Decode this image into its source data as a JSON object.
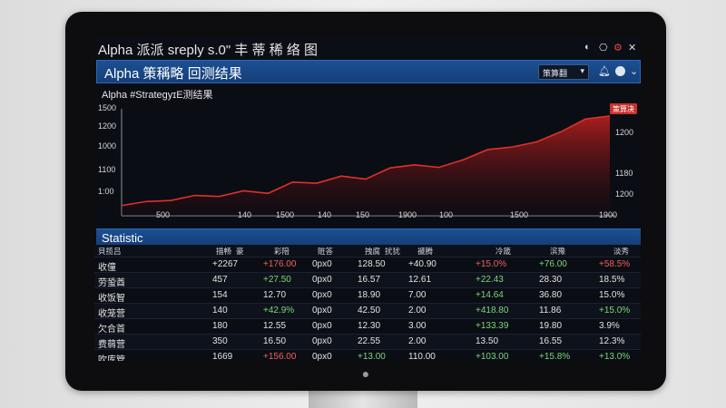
{
  "window": {
    "title": "Alpha 派派 sreply s.0\" 丰 蒂 稀 络 图",
    "controls": [
      "◐",
      "⎔",
      "⚙",
      "✕"
    ]
  },
  "header": {
    "title": "Alpha 策稱略 回测结果",
    "dropdown_label": "策算翻",
    "icons": [
      "bell-icon",
      "user-avatar",
      "chevron-down-icon"
    ]
  },
  "chart_title": "Alpha #StrategyɪЕ测结果",
  "chart_data": {
    "type": "area",
    "title": "Alpha #StrategyɪЕ测结果",
    "y_left_ticks": [
      "1500",
      "1200",
      "1000",
      "1100",
      "1:00"
    ],
    "y_right_ticks": [
      "1200",
      "1180",
      "1200"
    ],
    "x_ticks": [
      "500",
      "140",
      "1500",
      "140",
      "150",
      "1900",
      "100",
      "1500",
      "1900"
    ],
    "end_label": "策算决",
    "series": [
      {
        "values": [
          [
            0,
            600
          ],
          [
            5,
            640
          ],
          [
            10,
            650
          ],
          [
            15,
            700
          ],
          [
            20,
            690
          ],
          [
            25,
            745
          ],
          [
            30,
            720
          ],
          [
            35,
            830
          ],
          [
            40,
            820
          ],
          [
            45,
            890
          ],
          [
            50,
            860
          ],
          [
            55,
            970
          ],
          [
            60,
            1000
          ],
          [
            65,
            975
          ],
          [
            70,
            1050
          ],
          [
            75,
            1150
          ],
          [
            80,
            1175
          ],
          [
            85,
            1225
          ],
          [
            90,
            1325
          ],
          [
            95,
            1450
          ],
          [
            100,
            1480
          ]
        ]
      }
    ],
    "ylim": [
      500,
      1550
    ],
    "xlim": [
      0,
      100
    ],
    "color": "#e0302b"
  },
  "statistic": {
    "label": "Statistic",
    "columns": [
      "貝揽吕",
      "描畅",
      "豪",
      "彩陪",
      "赃答",
      "拽腐",
      "扰犹",
      "褫腾",
      "冷箴",
      "滨豫",
      "淡秀"
    ],
    "rows": [
      {
        "c0": "收僮",
        "c1": "+2267",
        "c2": "+176.00",
        "c3": "0px0",
        "c4": "128.50",
        "c5": "+40.90",
        "c6": "+15.0%",
        "c7": "+76.00",
        "c8": "+58.5%"
      },
      {
        "c0": "劳蛩酋",
        "c1": "457",
        "c2": "+27.50",
        "c3": "0px0",
        "c4": "16.57",
        "c5": "12.61",
        "c6": "+22.43",
        "c7": "28.30",
        "c8": "18.5%"
      },
      {
        "c0": "收饭智",
        "c1": "154",
        "c2": "12.70",
        "c3": "0px0",
        "c4": "18.90",
        "c5": "7.00",
        "c6": "+14.64",
        "c7": "36.80",
        "c8": "15.0%"
      },
      {
        "c0": "收笼营",
        "c1": "140",
        "c2": "+42.9%",
        "c3": "0px0",
        "c4": "42.50",
        "c5": "2.00",
        "c6": "+418.80",
        "c7": "11.86",
        "c8": "+15.0%"
      },
      {
        "c0": "欠合首",
        "c1": "180",
        "c2": "12.55",
        "c3": "0px0",
        "c4": "12.30",
        "c5": "3.00",
        "c6": "+133.39",
        "c7": "19.80",
        "c8": "3.9%"
      },
      {
        "c0": "费蒻营",
        "c1": "350",
        "c2": "16.50",
        "c3": "0px0",
        "c4": "22.55",
        "c5": "2.00",
        "c6": "13.50",
        "c7": "16.55",
        "c8": "12.3%"
      },
      {
        "c0": "吹库管",
        "c1": "1669",
        "c2": "+156.00",
        "c3": "0px0",
        "c4": "+13.00",
        "c5": "110.00",
        "c6": "+103.00",
        "c7": "+15.8%",
        "c8": "+13.0%"
      }
    ]
  }
}
